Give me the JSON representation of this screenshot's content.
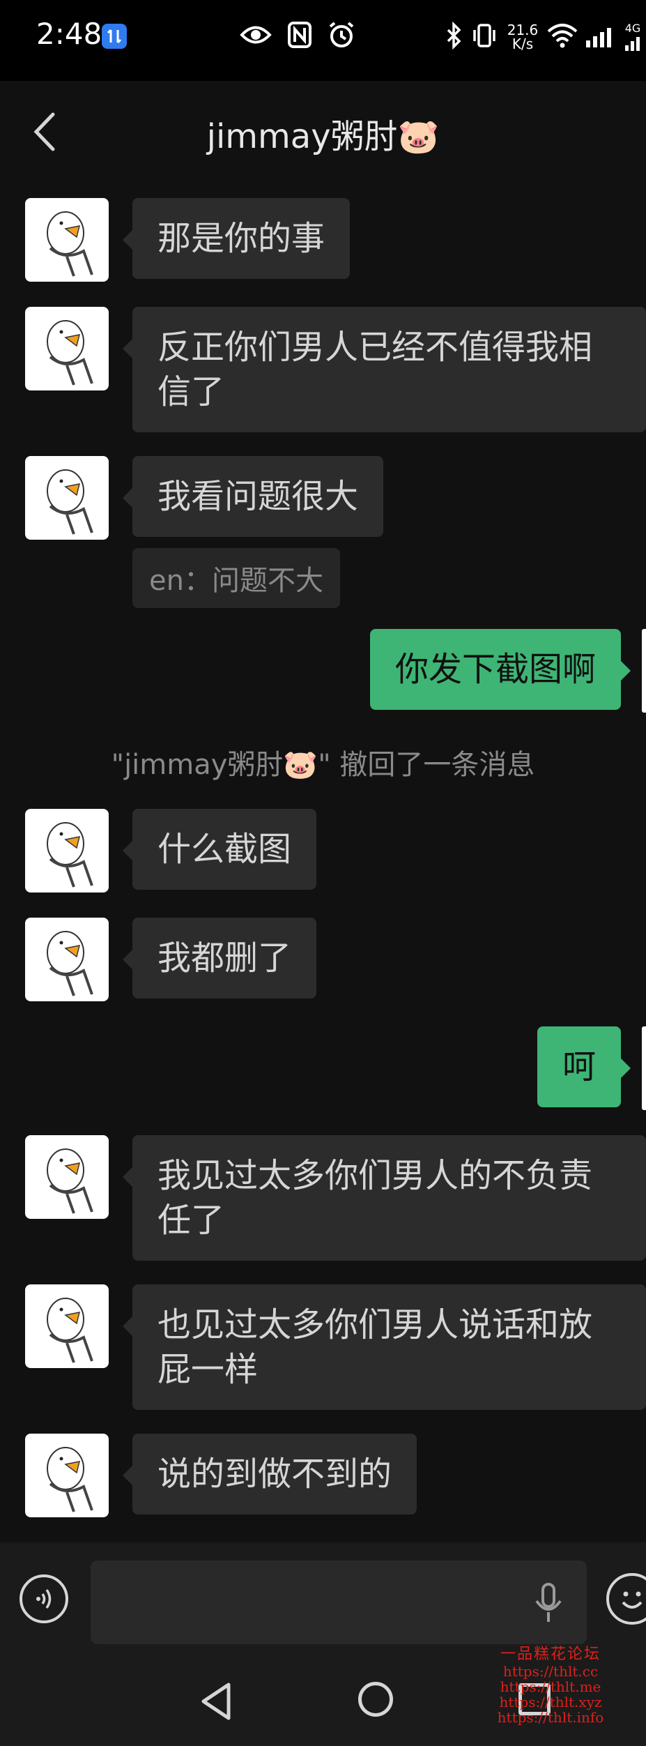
{
  "status_bar": {
    "time": "2:48",
    "net_speed_value": "21.6",
    "net_speed_unit": "K/s",
    "net_type": "4G"
  },
  "header": {
    "title": "jimmay粥肘🐷"
  },
  "messages": [
    {
      "side": "in",
      "text": "那是你的事"
    },
    {
      "side": "in",
      "lines": [
        "反正你们男人已经不值得我相",
        "信了"
      ]
    },
    {
      "side": "in",
      "text": "我看问题很大",
      "translation": "en：问题不大"
    },
    {
      "side": "out",
      "text": "你发下截图啊"
    },
    {
      "side": "system",
      "text": "\"jimmay粥肘🐷\" 撤回了一条消息"
    },
    {
      "side": "in",
      "text": "什么截图"
    },
    {
      "side": "in",
      "text": "我都删了"
    },
    {
      "side": "out",
      "text": "呵"
    },
    {
      "side": "in",
      "lines": [
        "我见过太多你们男人的不负责",
        "任了"
      ]
    },
    {
      "side": "in",
      "lines": [
        "也见过太多你们男人说话和放",
        "屁一样"
      ]
    },
    {
      "side": "in",
      "text": "说的到做不到的"
    }
  ],
  "input": {
    "value": "",
    "placeholder": ""
  },
  "watermark": {
    "title": "一品糕花论坛",
    "urls": [
      "https://thlt.cc",
      "https://thlt.me",
      "https://thlt.xyz",
      "https://thlt.info"
    ]
  },
  "colors": {
    "background": "#111111",
    "incoming_bubble": "#2c2c2c",
    "outgoing_bubble": "#3eb575",
    "watermark": "#e0201b"
  },
  "icons": {
    "back": "chevron-left-icon",
    "voice": "voice-mode-icon",
    "mic": "microphone-icon",
    "emoji": "emoji-icon",
    "nav_back": "triangle-back-icon",
    "nav_home": "circle-home-icon",
    "nav_recent": "square-recent-icon"
  }
}
